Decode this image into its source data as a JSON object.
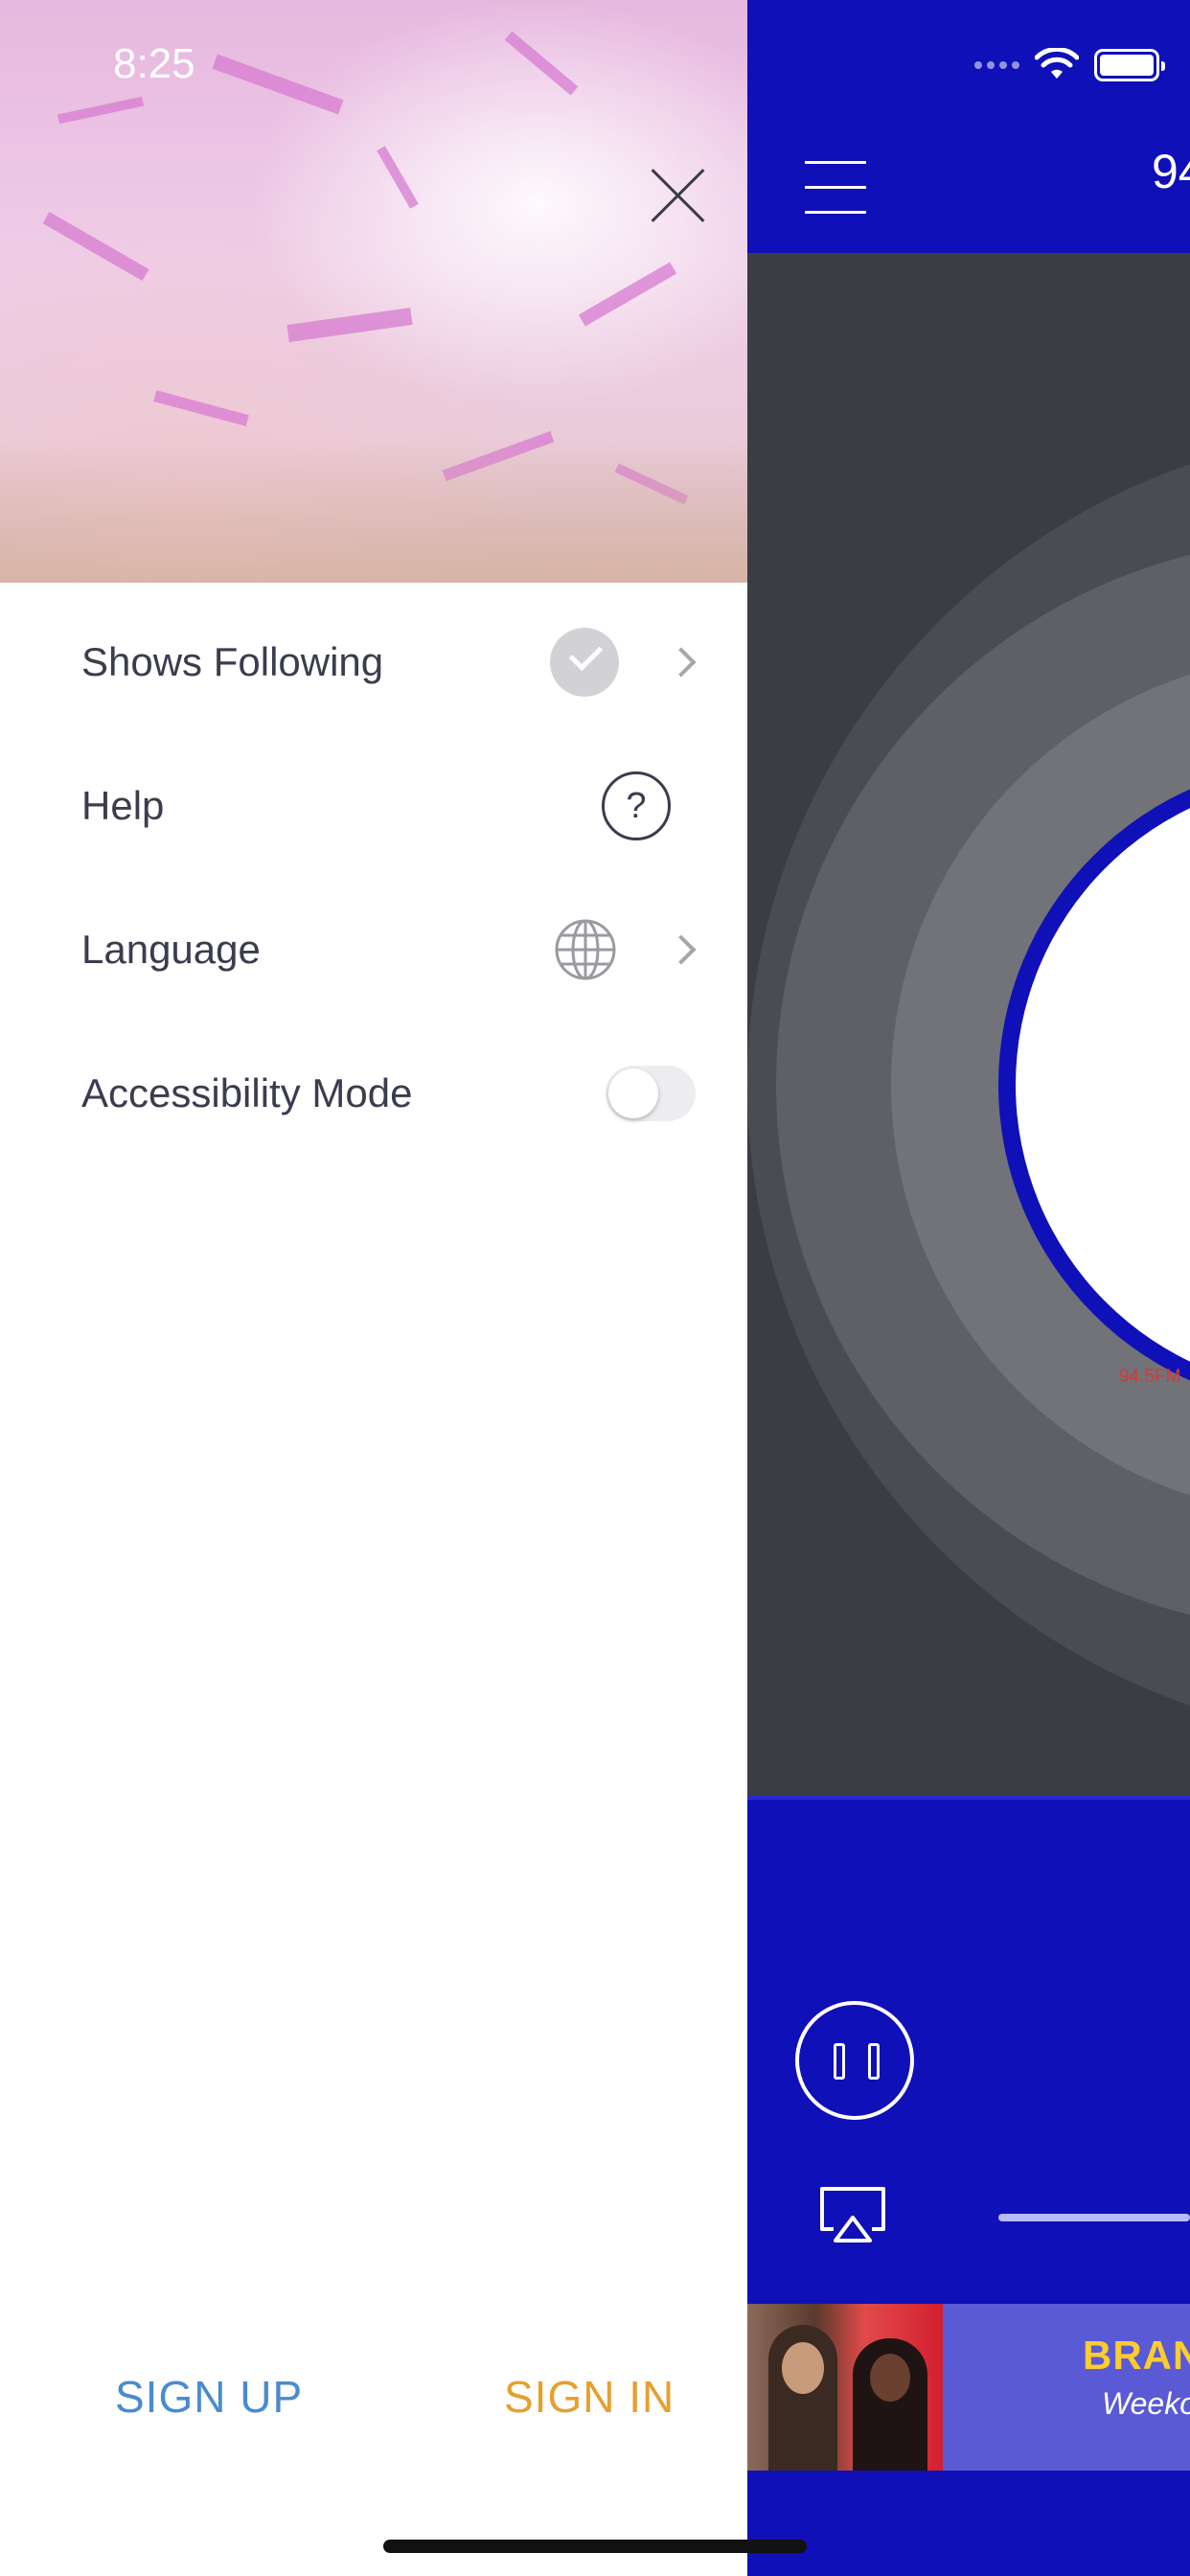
{
  "status_bar": {
    "time": "8:25"
  },
  "player": {
    "nav_title": "94",
    "station_label": "94.5FM",
    "ad": {
      "brand": "BRAN",
      "subtitle": "Weeko"
    }
  },
  "drawer": {
    "items": [
      {
        "label": "Shows Following",
        "icon": "check-circle-icon",
        "has_chevron": true
      },
      {
        "label": "Help",
        "icon": "help-icon",
        "has_chevron": false
      },
      {
        "label": "Language",
        "icon": "globe-icon",
        "has_chevron": true
      },
      {
        "label": "Accessibility Mode",
        "icon": "toggle",
        "toggle_on": false
      }
    ],
    "sign_up": "SIGN UP",
    "sign_in": "SIGN IN",
    "help_symbol": "?"
  },
  "colors": {
    "player_blue": "#1010b8",
    "sign_up": "#4a8bd0",
    "sign_in": "#e6a02e",
    "text": "#3b3d4e"
  }
}
